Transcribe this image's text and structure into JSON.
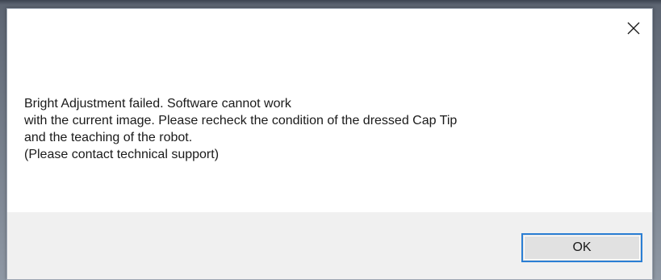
{
  "dialog": {
    "close_icon": "close-icon",
    "message_lines": [
      "Bright Adjustment failed. Software cannot work",
      "with the current image. Please recheck the condition of the dressed Cap Tip",
      "and the teaching of the robot.",
      "(Please contact technical support)"
    ],
    "ok_label": "OK"
  },
  "colors": {
    "dialog_background": "#ffffff",
    "footer_background": "#f0f0f0",
    "button_border_focus": "#2b7fd4",
    "button_background": "#e1e1e1",
    "text": "#1a1a1a"
  }
}
